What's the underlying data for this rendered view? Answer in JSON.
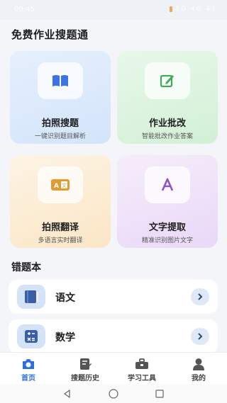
{
  "status": {
    "time": "09:45",
    "right": "5G 4G 45"
  },
  "app_title": "免费作业搜题通",
  "cards": [
    {
      "title": "拍照搜题",
      "subtitle": "一键识别题目解析",
      "icon": "book-icon",
      "accent": "#3d72e0"
    },
    {
      "title": "作业批改",
      "subtitle": "智能批改作业答案",
      "icon": "edit-icon",
      "accent": "#3daa5a"
    },
    {
      "title": "拍照翻译",
      "subtitle": "多语言实时翻译",
      "icon": "translate-icon",
      "accent": "#e49a32"
    },
    {
      "title": "文字提取",
      "subtitle": "精准识别图片文字",
      "icon": "text-a-icon",
      "accent": "#8a55c8"
    }
  ],
  "wrongbook": {
    "title": "错题本",
    "subjects": [
      {
        "label": "语文",
        "icon": "chinese-book-icon"
      },
      {
        "label": "数学",
        "icon": "calculator-icon"
      }
    ]
  },
  "tabs": [
    {
      "label": "首页",
      "icon": "camera-icon",
      "active": true
    },
    {
      "label": "搜题历史",
      "icon": "history-doc-icon",
      "active": false
    },
    {
      "label": "学习工具",
      "icon": "toolbox-icon",
      "active": false
    },
    {
      "label": "我的",
      "icon": "user-icon",
      "active": false
    }
  ],
  "colors": {
    "primary": "#2d6fe0",
    "background": "#f3f5f9"
  }
}
